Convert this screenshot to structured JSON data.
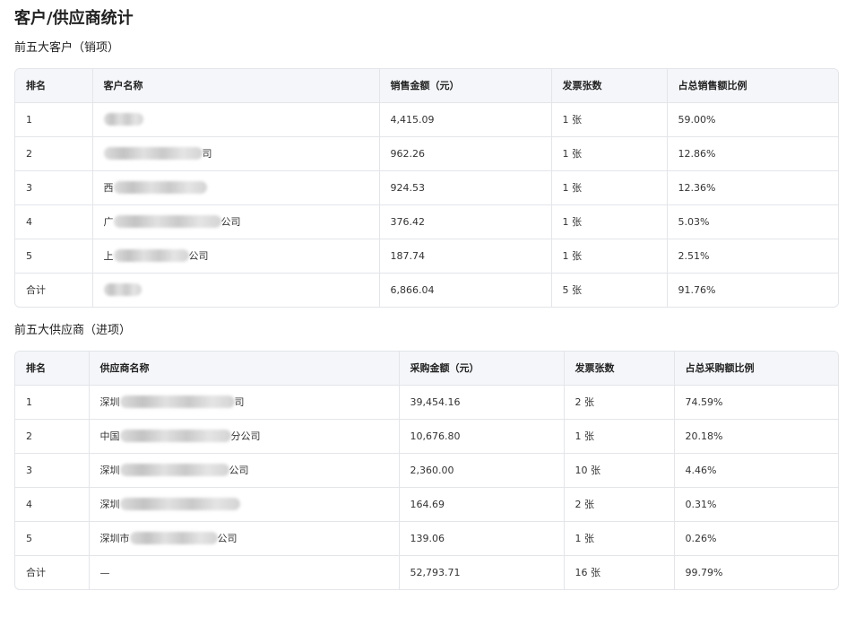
{
  "page_title": "客户/供应商统计",
  "customers": {
    "section_title": "前五大客户（销项）",
    "headers": [
      "排名",
      "客户名称",
      "销售金额（元）",
      "发票张数",
      "占总销售额比例"
    ],
    "rows": [
      {
        "rank": "1",
        "name_prefix": "",
        "name_suffix": "",
        "amount": "4,415.09",
        "invoices": "1 张",
        "ratio": "59.00%"
      },
      {
        "rank": "2",
        "name_prefix": "",
        "name_suffix": "司",
        "amount": "962.26",
        "invoices": "1 张",
        "ratio": "12.86%"
      },
      {
        "rank": "3",
        "name_prefix": "西",
        "name_suffix": "",
        "amount": "924.53",
        "invoices": "1 张",
        "ratio": "12.36%"
      },
      {
        "rank": "4",
        "name_prefix": "广",
        "name_suffix": "公司",
        "amount": "376.42",
        "invoices": "1 张",
        "ratio": "5.03%"
      },
      {
        "rank": "5",
        "name_prefix": "上",
        "name_suffix": "公司",
        "amount": "187.74",
        "invoices": "1 张",
        "ratio": "2.51%"
      },
      {
        "rank": "合计",
        "name_prefix": "",
        "name_suffix": "",
        "amount": "6,866.04",
        "invoices": "5 张",
        "ratio": "91.76%"
      }
    ]
  },
  "suppliers": {
    "section_title": "前五大供应商（进项）",
    "headers": [
      "排名",
      "供应商名称",
      "采购金额（元）",
      "发票张数",
      "占总采购额比例"
    ],
    "rows": [
      {
        "rank": "1",
        "name_prefix": "深圳",
        "name_suffix": "司",
        "amount": "39,454.16",
        "invoices": "2 张",
        "ratio": "74.59%"
      },
      {
        "rank": "2",
        "name_prefix": "中国",
        "name_suffix": "分公司",
        "amount": "10,676.80",
        "invoices": "1 张",
        "ratio": "20.18%"
      },
      {
        "rank": "3",
        "name_prefix": "深圳",
        "name_suffix": "公司",
        "amount": "2,360.00",
        "invoices": "10 张",
        "ratio": "4.46%"
      },
      {
        "rank": "4",
        "name_prefix": "深圳",
        "name_suffix": "",
        "amount": "164.69",
        "invoices": "2 张",
        "ratio": "0.31%"
      },
      {
        "rank": "5",
        "name_prefix": "深圳市",
        "name_suffix": "公司",
        "amount": "139.06",
        "invoices": "1 张",
        "ratio": "0.26%"
      },
      {
        "rank": "合计",
        "name_prefix": "—",
        "name_suffix": "",
        "amount": "52,793.71",
        "invoices": "16 张",
        "ratio": "99.79%"
      }
    ]
  }
}
